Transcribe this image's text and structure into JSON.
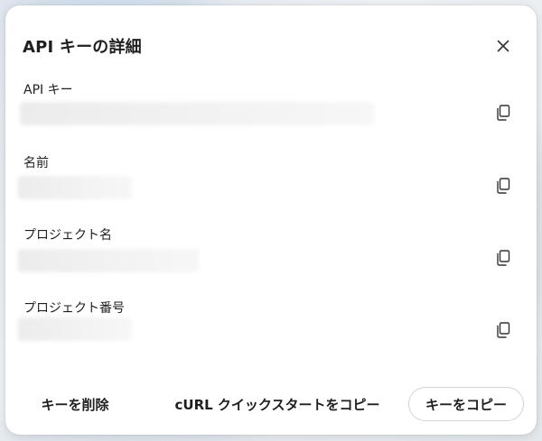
{
  "dialog": {
    "title": "API キーの詳細",
    "close_icon": "close-icon"
  },
  "fields": [
    {
      "label": "API キー",
      "value": "",
      "copy_icon": "copy-icon"
    },
    {
      "label": "名前",
      "value": "",
      "copy_icon": "copy-icon"
    },
    {
      "label": "プロジェクト名",
      "value": "",
      "copy_icon": "copy-icon"
    },
    {
      "label": "プロジェクト番号",
      "value": "",
      "copy_icon": "copy-icon"
    }
  ],
  "footer": {
    "delete_label": "キーを削除",
    "curl_label": "cURL クイックスタートをコピー",
    "copy_key_label": "キーをコピー"
  }
}
